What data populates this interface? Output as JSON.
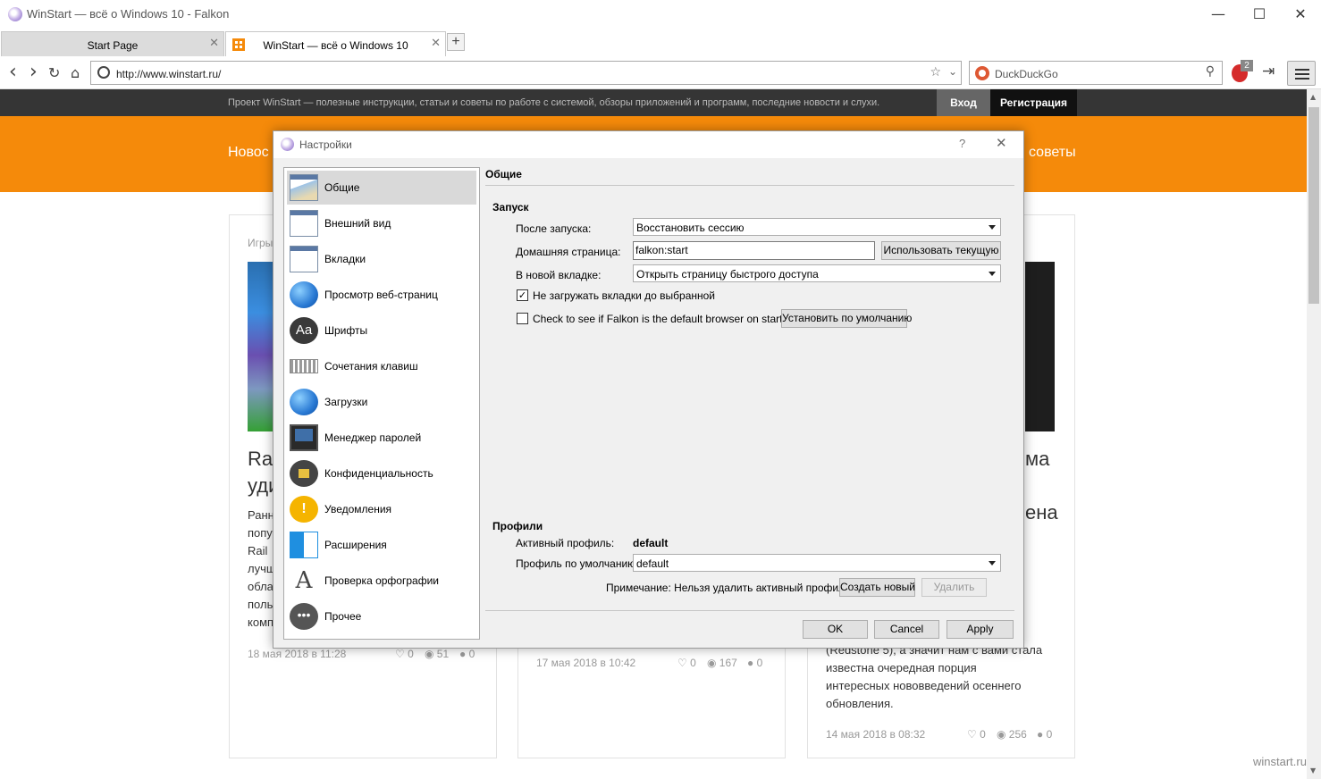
{
  "window": {
    "title": "WinStart — всё о Windows 10 - Falkon",
    "minimize": "—",
    "maximize": "☐",
    "close": "✕"
  },
  "tabs": [
    {
      "label": "Start Page",
      "close": "✕"
    },
    {
      "label": "WinStart — всё о Windows 10",
      "close": "✕"
    }
  ],
  "new_tab": "+",
  "nav": {
    "back": "‹",
    "forward": "›",
    "reload": "↻",
    "home": "⌂",
    "url": "http://www.winstart.ru/",
    "bookmark_star": "☆",
    "url_dropdown": "⌄",
    "search_engine": "DuckDuckGo",
    "search_icon": "⚲",
    "adblock_count": "2",
    "sidebar_toggle": "⇥"
  },
  "site": {
    "tagline": "Проект WinStart — полезные инструкции, статьи и советы по работе с системой, обзоры приложений и программ, последние новости и слухи.",
    "login": "Вход",
    "register": "Регистрация",
    "nav_left": "Новос",
    "nav_right": "советы",
    "card1": {
      "category": "Игры",
      "title_l1": "Rai",
      "title_l2": "уди",
      "lines": [
        "Ранн",
        "попу",
        "Rail",
        "лучш",
        "обла",
        "поль",
        "комп"
      ],
      "date": "18 мая 2018 в 11:28",
      "likes": "♡ 0",
      "views": "◉ 51",
      "comments": "● 0"
    },
    "card2": {
      "date": "17 мая 2018 в 10:42",
      "likes": "♡ 0",
      "views": "◉ 167",
      "comments": "● 0"
    },
    "card3": {
      "title_l1": "ма",
      "title_l2": "ена",
      "lines": [
        "(Redstone 5), а значит нам с вами стала",
        "известна очередная порция",
        "интересных нововведений осеннего",
        "обновления."
      ],
      "date": "14 мая 2018 в 08:32",
      "likes": "♡ 0",
      "views": "◉ 256",
      "comments": "● 0"
    },
    "watermark": "winstart.ru"
  },
  "dialog": {
    "title": "Настройки",
    "help": "?",
    "close": "✕",
    "sidebar": [
      {
        "label": "Общие",
        "selected": true
      },
      {
        "label": "Внешний вид"
      },
      {
        "label": "Вкладки"
      },
      {
        "label": "Просмотр веб-страниц"
      },
      {
        "label": "Шрифты",
        "glyph": "Aa"
      },
      {
        "label": "Сочетания клавиш"
      },
      {
        "label": "Загрузки"
      },
      {
        "label": "Менеджер паролей"
      },
      {
        "label": "Конфиденциальность"
      },
      {
        "label": "Уведомления",
        "glyph": "!"
      },
      {
        "label": "Расширения"
      },
      {
        "label": "Проверка орфографии",
        "glyph": "A"
      },
      {
        "label": "Прочее",
        "glyph": "•••"
      }
    ],
    "heading": "Общие",
    "startup": {
      "section": "Запуск",
      "after_launch_label": "После запуска:",
      "after_launch_value": "Восстановить сессию",
      "homepage_label": "Домашняя страница:",
      "homepage_value": "falkon:start",
      "use_current": "Использовать текущую",
      "new_tab_label": "В новой вкладке:",
      "new_tab_value": "Открыть страницу быстрого доступа",
      "lazy_tabs_label": "Не загружать вкладки до выбранной",
      "lazy_tabs_checked": "✓",
      "default_check_label": "Check to see if Falkon is the default browser on startup",
      "set_default": "Установить по умолчанию"
    },
    "profiles": {
      "section": "Профили",
      "active_label": "Активный профиль:",
      "active_value": "default",
      "default_label": "Профиль по умолчанию:",
      "default_value": "default",
      "note": "Примечание: Нельзя удалить активный профиль.",
      "create": "Создать новый",
      "delete": "Удалить"
    },
    "buttons": {
      "ok": "OK",
      "cancel": "Cancel",
      "apply": "Apply"
    }
  }
}
